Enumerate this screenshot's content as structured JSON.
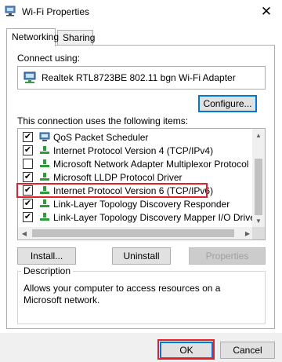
{
  "window": {
    "title": "Wi-Fi Properties",
    "close_glyph": "✕"
  },
  "tabs": [
    {
      "label": "Networking",
      "active": true
    },
    {
      "label": "Sharing",
      "active": false
    }
  ],
  "networking": {
    "connect_using_label": "Connect using:",
    "adapter_name": "Realtek RTL8723BE 802.11 bgn Wi-Fi Adapter",
    "configure_button": "Configure...",
    "items_label": "This connection uses the following items:",
    "items": [
      {
        "label": "QoS Packet Scheduler",
        "checked": true,
        "icon": "qos-icon"
      },
      {
        "label": "Internet Protocol Version 4 (TCP/IPv4)",
        "checked": true,
        "icon": "protocol-icon"
      },
      {
        "label": "Microsoft Network Adapter Multiplexor Protocol",
        "checked": false,
        "icon": "protocol-icon"
      },
      {
        "label": "Microsoft LLDP Protocol Driver",
        "checked": true,
        "icon": "protocol-icon"
      },
      {
        "label": "Internet Protocol Version 6 (TCP/IPv6)",
        "checked": true,
        "icon": "protocol-icon",
        "highlighted": true
      },
      {
        "label": "Link-Layer Topology Discovery Responder",
        "checked": true,
        "icon": "protocol-icon"
      },
      {
        "label": "Link-Layer Topology Discovery Mapper I/O Driver",
        "checked": true,
        "icon": "protocol-icon"
      }
    ],
    "install_button": "Install...",
    "uninstall_button": "Uninstall",
    "properties_button": "Properties",
    "description_label": "Description",
    "description_text": "Allows your computer to access resources on a Microsoft network."
  },
  "footer": {
    "ok_button": "OK",
    "cancel_button": "Cancel"
  },
  "colors": {
    "highlight_border": "#e0202a",
    "focus_border": "#0078d7",
    "protocol_green": "#2e9c3a"
  }
}
